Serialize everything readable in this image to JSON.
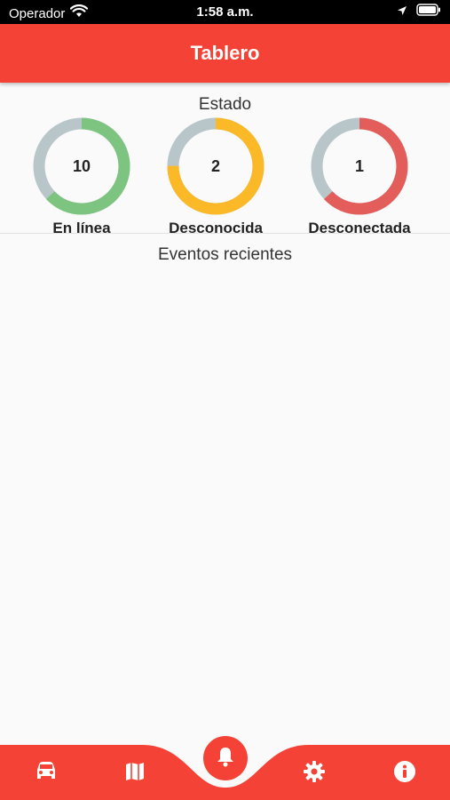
{
  "status_bar": {
    "carrier": "Operador",
    "time": "1:58 a.m.",
    "icons": [
      "wifi-icon",
      "location-arrow-icon",
      "battery-icon"
    ]
  },
  "app_bar": {
    "title": "Tablero"
  },
  "status_section": {
    "title": "Estado",
    "gauges": [
      {
        "value": "10",
        "label": "En línea",
        "fraction": 0.63,
        "color": "#7cc47f"
      },
      {
        "value": "2",
        "label": "Desconocida",
        "fraction": 0.75,
        "color": "#fbb827"
      },
      {
        "value": "1",
        "label": "Desconectada",
        "fraction": 0.63,
        "color": "#e35d5b"
      }
    ],
    "track_color": "#b8c6ca"
  },
  "recent_events": {
    "title": "Eventos recientes"
  },
  "bottom_nav": {
    "items": [
      "car-icon",
      "map-icon",
      "bell-icon",
      "settings-icon",
      "info-icon"
    ],
    "active": "bell-icon",
    "color": "#f44336"
  }
}
